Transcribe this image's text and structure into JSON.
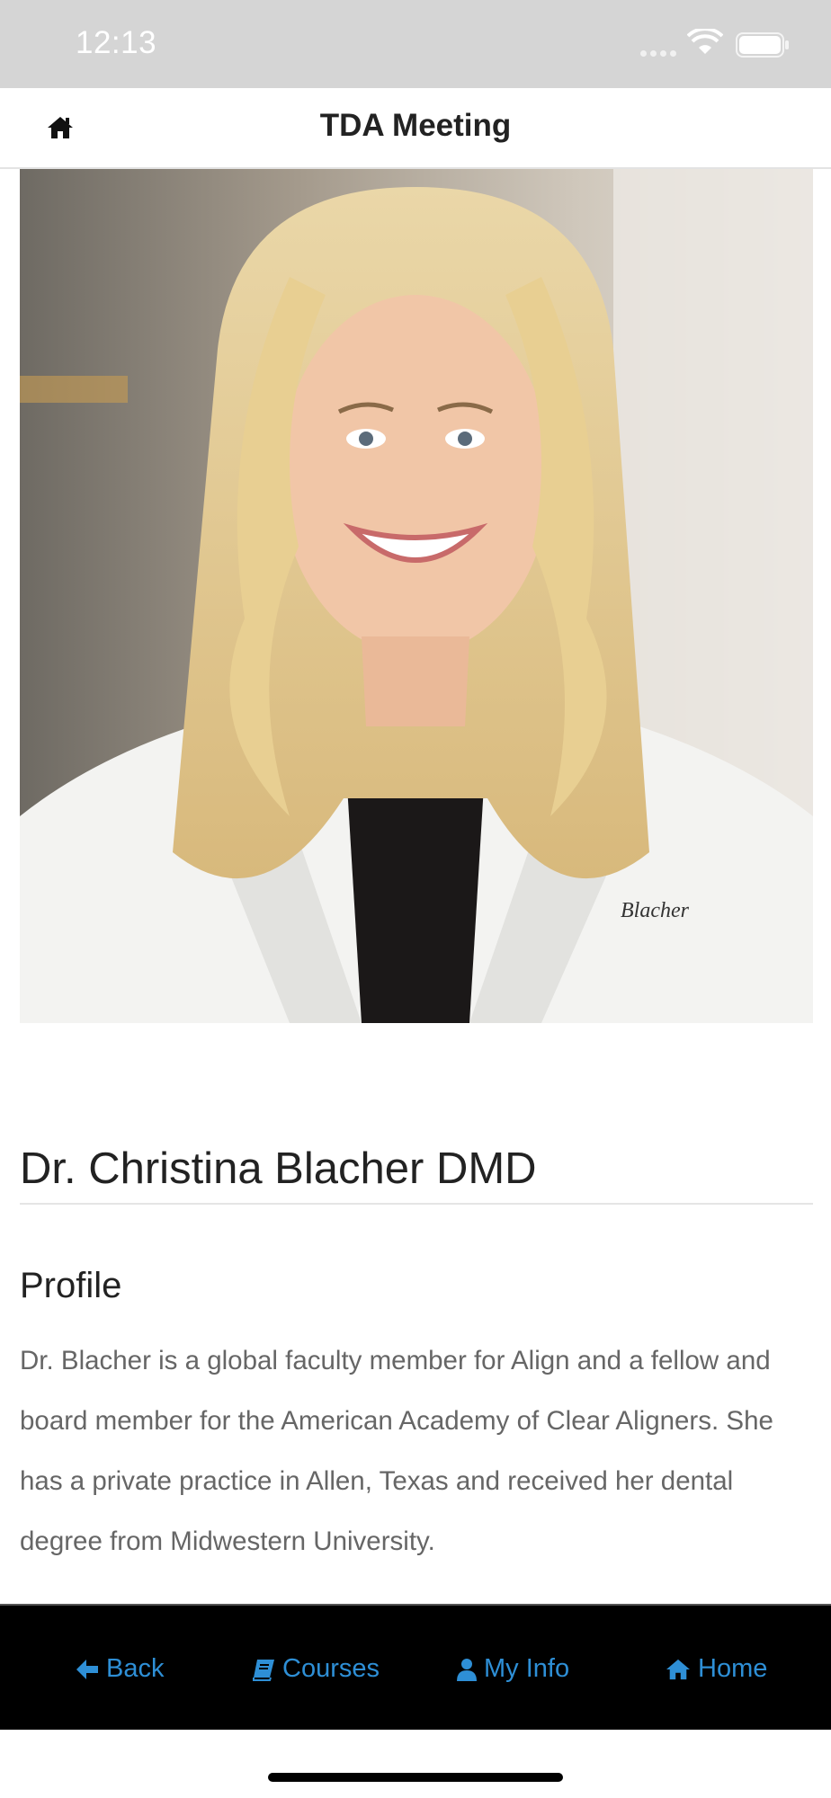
{
  "status_bar": {
    "time": "12:13"
  },
  "nav": {
    "title": "TDA Meeting",
    "home_icon": "home-icon"
  },
  "speaker": {
    "photo_label": "speaker-photo",
    "coat_embroidery": "Blacher",
    "name": "Dr. Christina Blacher DMD",
    "profile_heading": "Profile",
    "bio": "Dr. Blacher is a global faculty member for Align and a fellow and board member for the American Academy of Clear Aligners. She has a private practice in Allen, Texas and received her dental degree from Midwestern University."
  },
  "tabs": [
    {
      "label": "Back",
      "icon": "arrow-left-icon"
    },
    {
      "label": "Courses",
      "icon": "book-icon"
    },
    {
      "label": "My Info",
      "icon": "user-icon"
    },
    {
      "label": "Home",
      "icon": "home-icon"
    }
  ],
  "colors": {
    "accent": "#2e8fd6",
    "tab_bar": "#000000",
    "status_bar": "#d5d5d5"
  }
}
